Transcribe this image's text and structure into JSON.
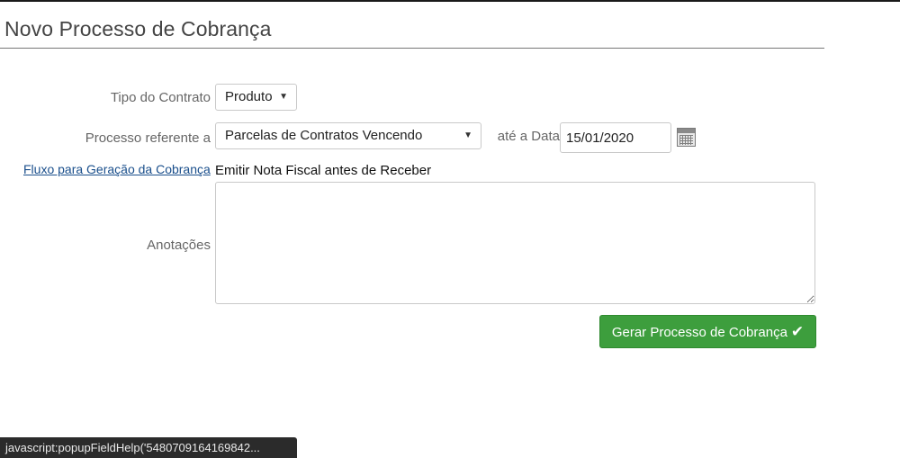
{
  "page": {
    "title": "Novo Processo de Cobrança"
  },
  "form": {
    "contract_type_label": "Tipo do Contrato",
    "contract_type_value": "Produto",
    "process_label": "Processo referente a",
    "process_value": "Parcelas de Contratos Vencendo",
    "until_date_label": "até a Data",
    "until_date_value": "15/01/2020",
    "flow_link_label": "Fluxo para Geração da Cobrança",
    "flow_value": "Emitir Nota Fiscal antes de Receber",
    "notes_label": "Anotações",
    "notes_value": ""
  },
  "actions": {
    "submit_label": "Gerar Processo de Cobrança",
    "submit_icon": "checkmark-icon"
  },
  "status_bar": {
    "text": "javascript:popupFieldHelp('5480709164169842..."
  },
  "colors": {
    "submit_bg": "#3d9e3d",
    "link": "#1a4f8c",
    "status_bar_bg": "#2b2b2b"
  }
}
